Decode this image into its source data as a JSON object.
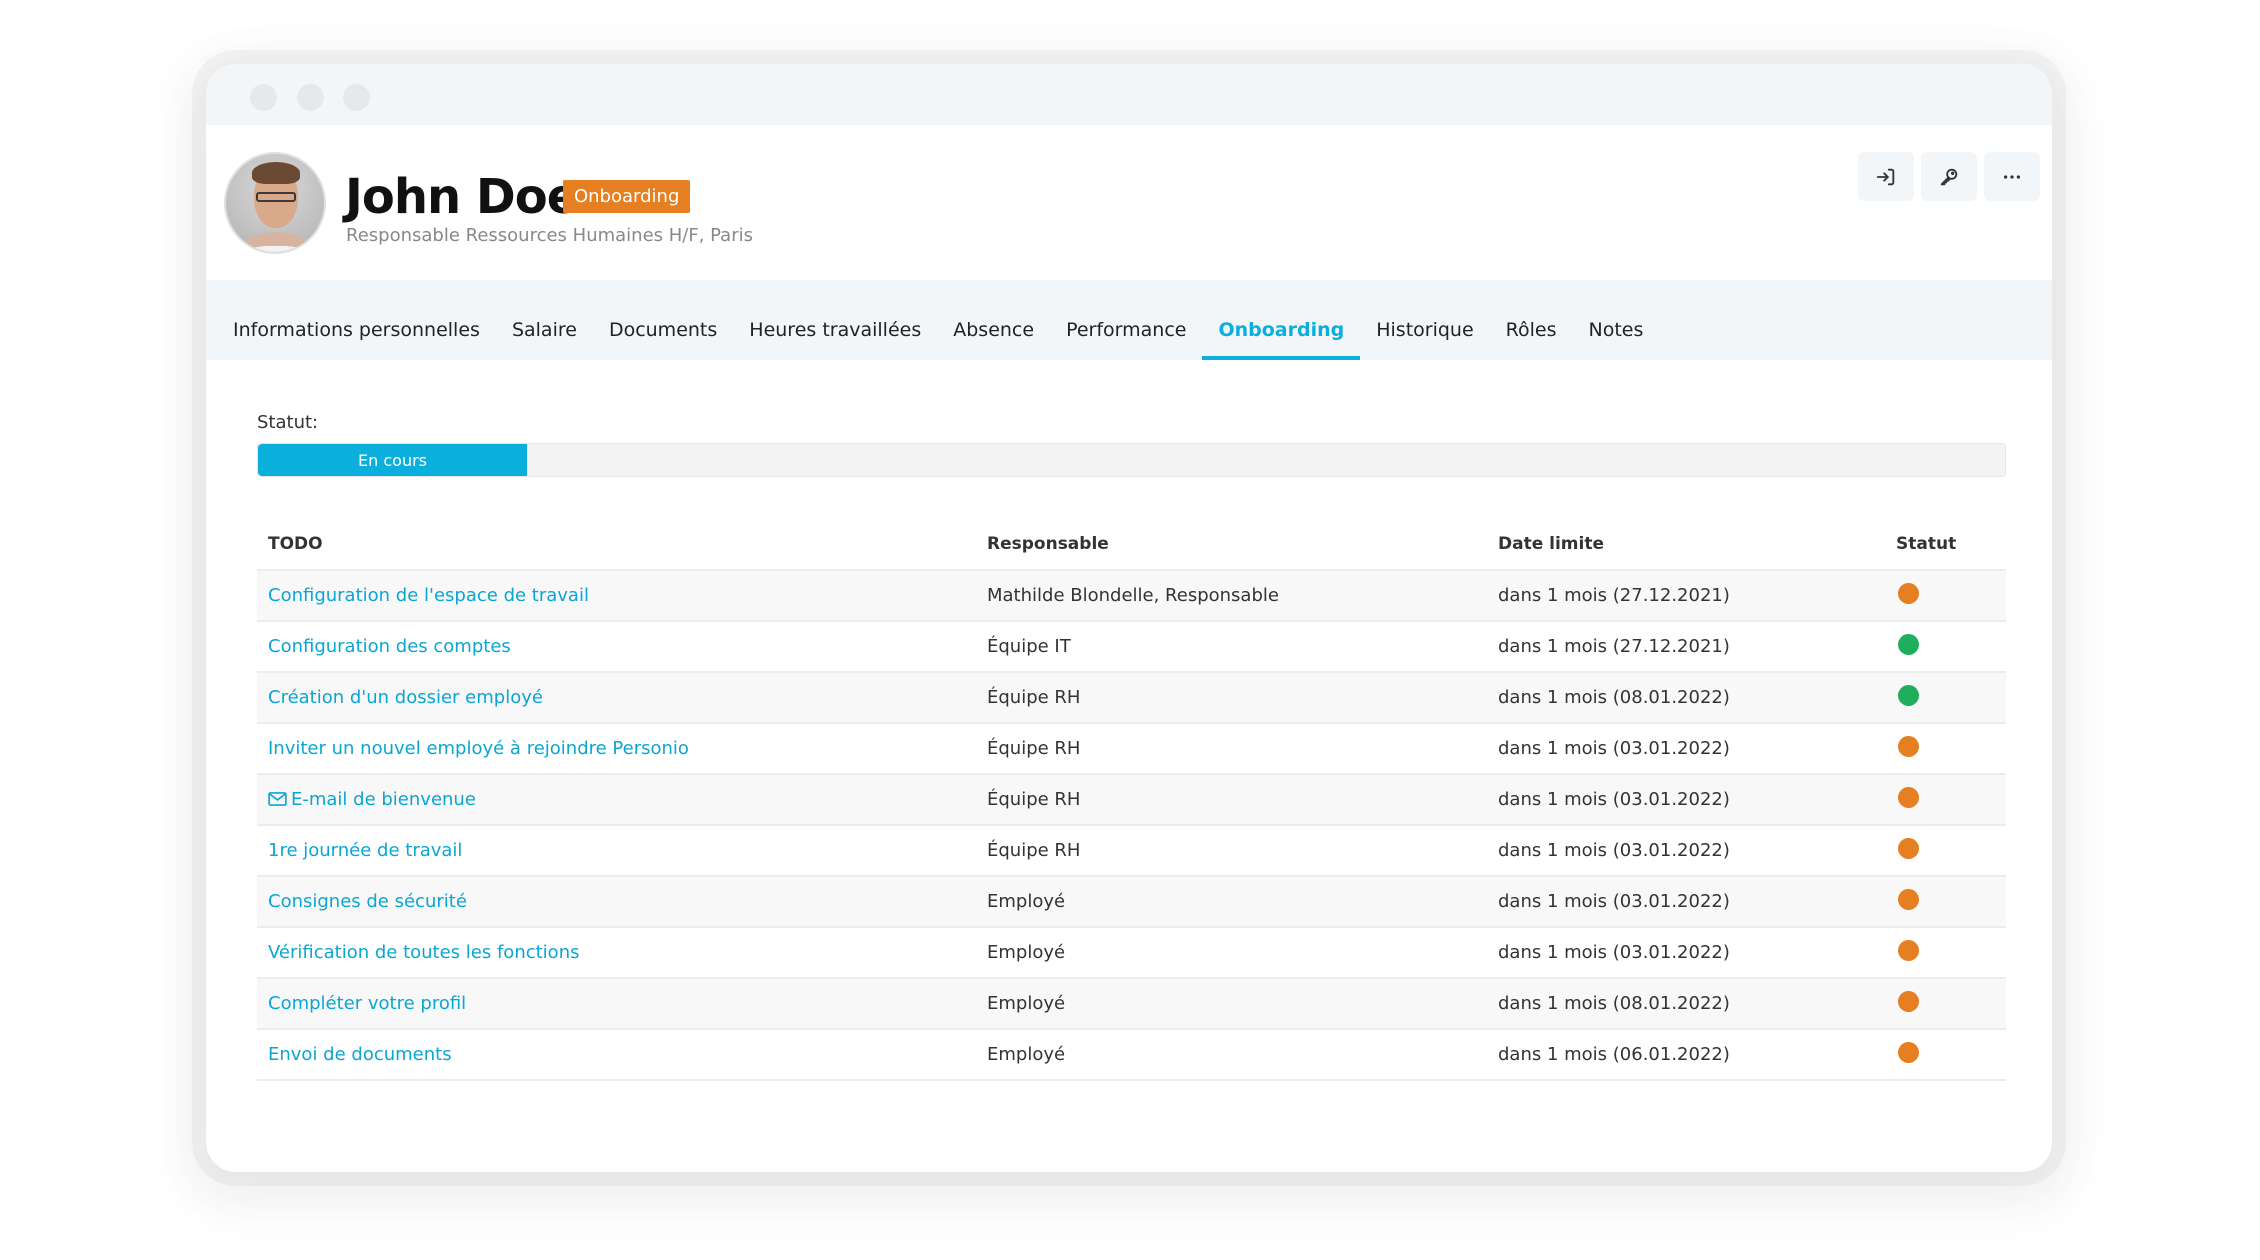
{
  "window": {
    "controls": [
      "dot",
      "dot",
      "dot"
    ]
  },
  "profile": {
    "name": "John Doe",
    "badge": "Onboarding",
    "subtitle": "Responsable Ressources Humaines H/F, Paris",
    "badge_color": "#e67e22"
  },
  "header_actions": [
    {
      "icon": "sign-in-icon",
      "label": "Se connecter en tant que"
    },
    {
      "icon": "key-icon",
      "label": "Accès"
    },
    {
      "icon": "more-icon",
      "label": "Plus"
    }
  ],
  "tabs": [
    {
      "label": "Informations personnelles",
      "active": false
    },
    {
      "label": "Salaire",
      "active": false
    },
    {
      "label": "Documents",
      "active": false
    },
    {
      "label": "Heures travaillées",
      "active": false
    },
    {
      "label": "Absence",
      "active": false
    },
    {
      "label": "Performance",
      "active": false
    },
    {
      "label": "Onboarding",
      "active": true
    },
    {
      "label": "Historique",
      "active": false
    },
    {
      "label": "Rôles",
      "active": false
    },
    {
      "label": "Notes",
      "active": false
    }
  ],
  "accent_color": "#0aafdb",
  "status": {
    "label": "Statut:",
    "progress_label": "En cours",
    "progress_fraction": 0.154
  },
  "table": {
    "headers": {
      "todo": "TODO",
      "responsible": "Responsable",
      "due": "Date limite",
      "status": "Statut"
    },
    "status_colors": {
      "pending": "#e67e22",
      "done": "#1fae5b"
    },
    "rows": [
      {
        "todo": "Configuration de l'espace de travail",
        "icon": null,
        "responsible": "Mathilde Blondelle, Responsable",
        "due": "dans 1 mois (27.12.2021)",
        "status": "pending"
      },
      {
        "todo": "Configuration des comptes",
        "icon": null,
        "responsible": "Équipe IT",
        "due": "dans 1 mois (27.12.2021)",
        "status": "done"
      },
      {
        "todo": "Création d'un dossier employé",
        "icon": null,
        "responsible": "Équipe RH",
        "due": "dans 1 mois (08.01.2022)",
        "status": "done"
      },
      {
        "todo": "Inviter un nouvel employé à rejoindre Personio",
        "icon": null,
        "responsible": "Équipe RH",
        "due": "dans 1 mois (03.01.2022)",
        "status": "pending"
      },
      {
        "todo": "E-mail de bienvenue",
        "icon": "mail-icon",
        "responsible": "Équipe RH",
        "due": "dans 1 mois (03.01.2022)",
        "status": "pending"
      },
      {
        "todo": "1re journée de travail",
        "icon": null,
        "responsible": "Équipe RH",
        "due": "dans 1 mois (03.01.2022)",
        "status": "pending"
      },
      {
        "todo": "Consignes de sécurité",
        "icon": null,
        "responsible": "Employé",
        "due": "dans 1 mois (03.01.2022)",
        "status": "pending"
      },
      {
        "todo": "Vérification de toutes les fonctions",
        "icon": null,
        "responsible": "Employé",
        "due": "dans 1 mois (03.01.2022)",
        "status": "pending"
      },
      {
        "todo": "Compléter votre profil",
        "icon": null,
        "responsible": "Employé",
        "due": "dans 1 mois (08.01.2022)",
        "status": "pending"
      },
      {
        "todo": "Envoi de documents",
        "icon": null,
        "responsible": "Employé",
        "due": "dans 1 mois (06.01.2022)",
        "status": "pending"
      }
    ]
  }
}
